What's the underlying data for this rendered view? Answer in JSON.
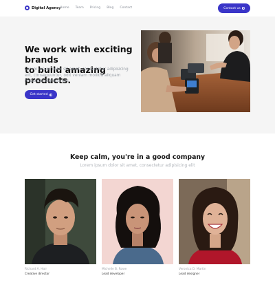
{
  "nav": {
    "brand": "Digital Agency",
    "links": [
      "Home",
      "Team",
      "Pricing",
      "Blog",
      "Contact"
    ],
    "cta": "Contact us"
  },
  "hero": {
    "title_line1": "We work with exciting brands",
    "title_line2": "to build amazing products.",
    "text": "Lorem ipsum dolor sit amet, consectetur adipisicing elit, consequuntur, odit veniam mollitia aliquam reiciendis dignissimos.",
    "button": "Get started"
  },
  "team": {
    "title": "Keep calm, you're in a good company",
    "subtitle": "Lorem ipsum dolor sit amet, consectetur adipisicing elit",
    "members": [
      {
        "name": "Richard A. Hair",
        "role": "Creative director"
      },
      {
        "name": "Michelle B. Rowe",
        "role": "Lead developer"
      },
      {
        "name": "Veronica D. Martin",
        "role": "Lead designer"
      }
    ]
  },
  "colors": {
    "accent": "#3a35c8",
    "hero_bg": "#f5f5f5",
    "muted_text": "#9aa0a8"
  },
  "icons": {
    "brand": "brand-dot-icon",
    "arrow": "arrow-right-circle-icon"
  }
}
